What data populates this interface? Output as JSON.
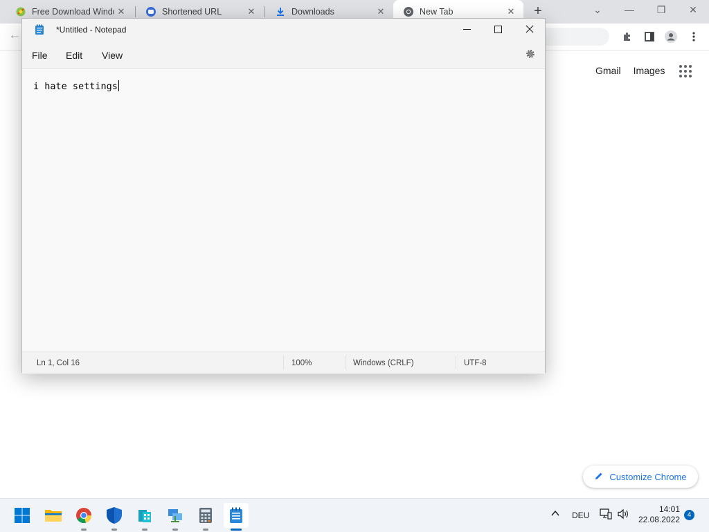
{
  "chrome": {
    "tabs": [
      {
        "label": "Free Download Windows",
        "icon": "software-site-icon",
        "active": false
      },
      {
        "label": "Shortened URL",
        "icon": "link-shortener-icon",
        "active": false
      },
      {
        "label": "Downloads",
        "icon": "download-icon",
        "active": false
      },
      {
        "label": "New Tab",
        "icon": "chrome-icon",
        "active": true
      }
    ],
    "tab_close_glyph": "✕",
    "new_tab_glyph": "+",
    "window_controls": {
      "dropdown": "⌄",
      "minimize": "—",
      "maximize": "❐",
      "close": "✕"
    },
    "header_links": {
      "gmail": "Gmail",
      "images": "Images"
    },
    "customize_label": "Customize Chrome"
  },
  "notepad": {
    "title": "*Untitled - Notepad",
    "menu": {
      "file": "File",
      "edit": "Edit",
      "view": "View"
    },
    "content": "i hate settings",
    "status": {
      "position": "Ln 1, Col 16",
      "zoom": "100%",
      "line_endings": "Windows (CRLF)",
      "encoding": "UTF-8"
    }
  },
  "taskbar": {
    "apps": [
      "start-icon",
      "file-explorer-icon",
      "chrome-icon",
      "windows-security-icon",
      "app-icon",
      "network-app-icon",
      "calculator-icon",
      "notepad-icon"
    ],
    "tray": {
      "language": "DEU",
      "time": "14:01",
      "date": "22.08.2022",
      "notifications": "4"
    }
  },
  "colors": {
    "accent": "#0067c0",
    "chrome_link": "#1a73e8",
    "tabbar": "#dfe1e5"
  }
}
